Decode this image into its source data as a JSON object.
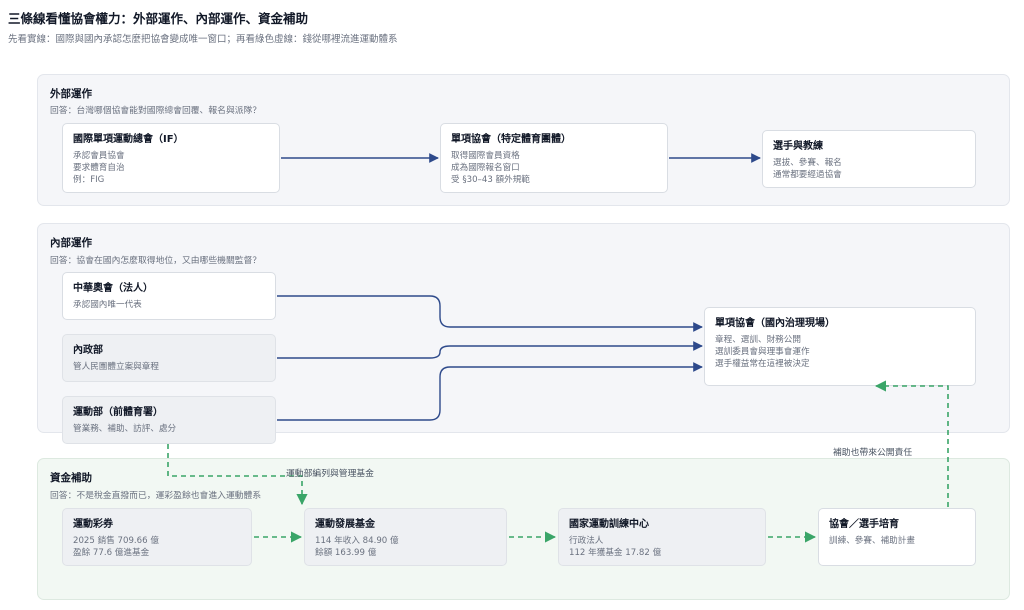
{
  "title": "三條線看懂協會權力：外部運作、內部運作、資金補助",
  "subtitle": "先看實線：國際與國內承認怎麼把協會變成唯一窗口；再看綠色虛線：錢從哪裡流進運動體系",
  "sections": {
    "external": {
      "title": "外部運作",
      "question": "回答：台灣哪個協會能對國際總會回覆、報名與派隊？",
      "boxes": [
        {
          "title": "國際單項運動總會（IF）",
          "lines": [
            "承認會員協會",
            "要求體育自治",
            "例：FIG"
          ]
        },
        {
          "title": "單項協會（特定體育團體）",
          "lines": [
            "取得國際會員資格",
            "成為國際報名窗口",
            "受 §30–43 額外規範"
          ]
        },
        {
          "title": "選手與教練",
          "lines": [
            "選拔、參賽、報名",
            "通常都要經過協會"
          ]
        }
      ]
    },
    "internal": {
      "title": "內部運作",
      "question": "回答：協會在國內怎麼取得地位，又由哪些機關監督？",
      "boxes": [
        {
          "title": "中華奧會（法人）",
          "lines": [
            "承認國內唯一代表"
          ]
        },
        {
          "title": "內政部",
          "lines": [
            "管人民團體立案與章程"
          ]
        },
        {
          "title": "運動部（前體育署）",
          "lines": [
            "管業務、補助、訪評、處分"
          ]
        },
        {
          "title": "單項協會（國內治理現場）",
          "lines": [
            "章程、選訓、財務公開",
            "選訓委員會與理事會運作",
            "選手權益常在這裡被決定"
          ]
        }
      ]
    },
    "funding": {
      "title": "資金補助",
      "question": "回答：不是稅金直撥而已，運彩盈餘也會進入運動體系",
      "boxes": [
        {
          "title": "運動彩券",
          "lines": [
            "2025 銷售 709.66 億",
            "盈餘 77.6 億進基金"
          ]
        },
        {
          "title": "運動發展基金",
          "lines": [
            "114 年收入 84.90 億",
            "餘額 163.99 億"
          ]
        },
        {
          "title": "國家運動訓練中心",
          "lines": [
            "行政法人",
            "112 年獲基金 17.82 億"
          ]
        },
        {
          "title": "協會／選手培育",
          "lines": [
            "訓練、參賽、補助計畫"
          ]
        }
      ]
    }
  },
  "edge_labels": {
    "ministry_fund": "運動部編列與管理基金",
    "accountability": "補助也帶來公開責任"
  },
  "colors": {
    "solid": "#2e4a8b",
    "dashed": "#3aa568"
  }
}
